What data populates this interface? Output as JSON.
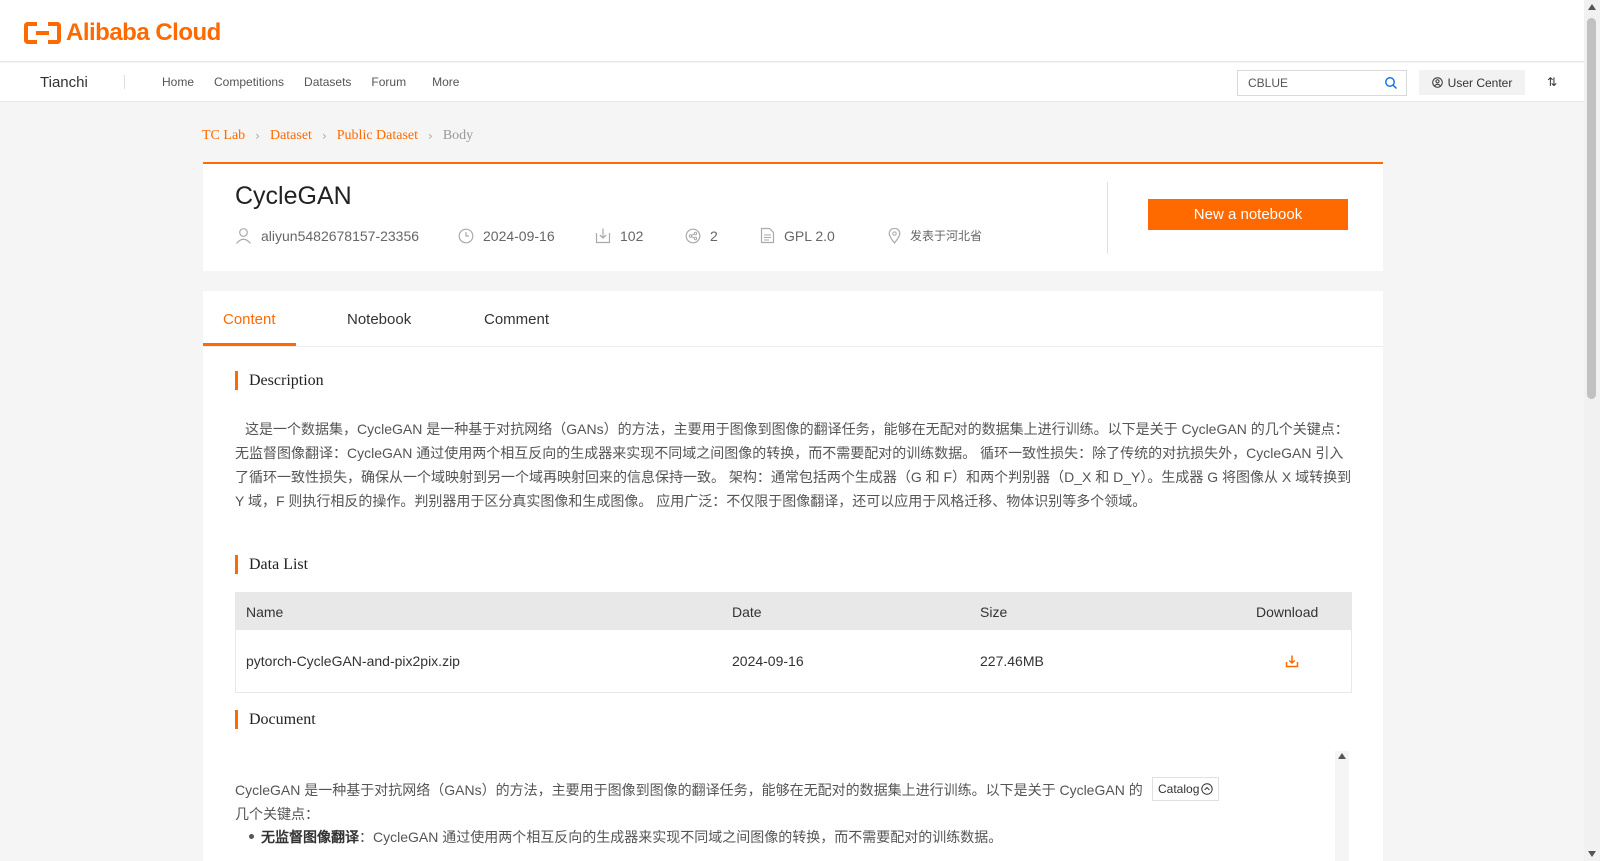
{
  "header": {
    "logo_text": "Alibaba Cloud"
  },
  "nav": {
    "brand": "Tianchi",
    "links": [
      "Home",
      "Competitions",
      "Datasets",
      "Forum",
      "More"
    ],
    "search_value": "CBLUE",
    "user_center": "User Center"
  },
  "breadcrumb": [
    "TC Lab",
    "Dataset",
    "Public Dataset",
    "Body"
  ],
  "dataset": {
    "title": "CycleGAN",
    "author": "aliyun5482678157-23356",
    "date": "2024-09-16",
    "downloads": "102",
    "shares": "2",
    "license": "GPL 2.0",
    "location": "发表于河北省",
    "new_notebook": "New a notebook"
  },
  "tabs": [
    "Content",
    "Notebook",
    "Comment"
  ],
  "sections": {
    "description_title": "Description",
    "description": "这是一个数据集，CycleGAN 是一种基于对抗网络（GANs）的方法，主要用于图像到图像的翻译任务，能够在无配对的数据集上进行训练。以下是关于 CycleGAN 的几个关键点：无监督图像翻译：CycleGAN 通过使用两个相互反向的生成器来实现不同域之间图像的转换，而不需要配对的训练数据。 循环一致性损失：除了传统的对抗损失外，CycleGAN 引入了循环一致性损失，确保从一个域映射到另一个域再映射回来的信息保持一致。 架构：通常包括两个生成器（G 和 F）和两个判别器（D_X 和 D_Y）。生成器 G 将图像从 X 域转换到 Y 域，F 则执行相反的操作。判别器用于区分真实图像和生成图像。 应用广泛：不仅限于图像翻译，还可以应用于风格迁移、物体识别等多个领域。",
    "data_list_title": "Data List",
    "document_title": "Document"
  },
  "data_table": {
    "headers": [
      "Name",
      "Date",
      "Size",
      "Download"
    ],
    "rows": [
      {
        "name": "pytorch-CycleGAN-and-pix2pix.zip",
        "date": "2024-09-16",
        "size": "227.46MB"
      }
    ]
  },
  "document": {
    "intro": "CycleGAN 是一种基于对抗网络（GANs）的方法，主要用于图像到图像的翻译任务，能够在无配对的数据集上进行训练。以下是关于 CycleGAN 的几个关键点：",
    "catalog": "Catalog",
    "bullet_bold": "无监督图像翻译",
    "bullet_text": "：CycleGAN 通过使用两个相互反向的生成器来实现不同域之间图像的转换，而不需要配对的训练数据。"
  },
  "colors": {
    "accent": "#ff6a00"
  }
}
